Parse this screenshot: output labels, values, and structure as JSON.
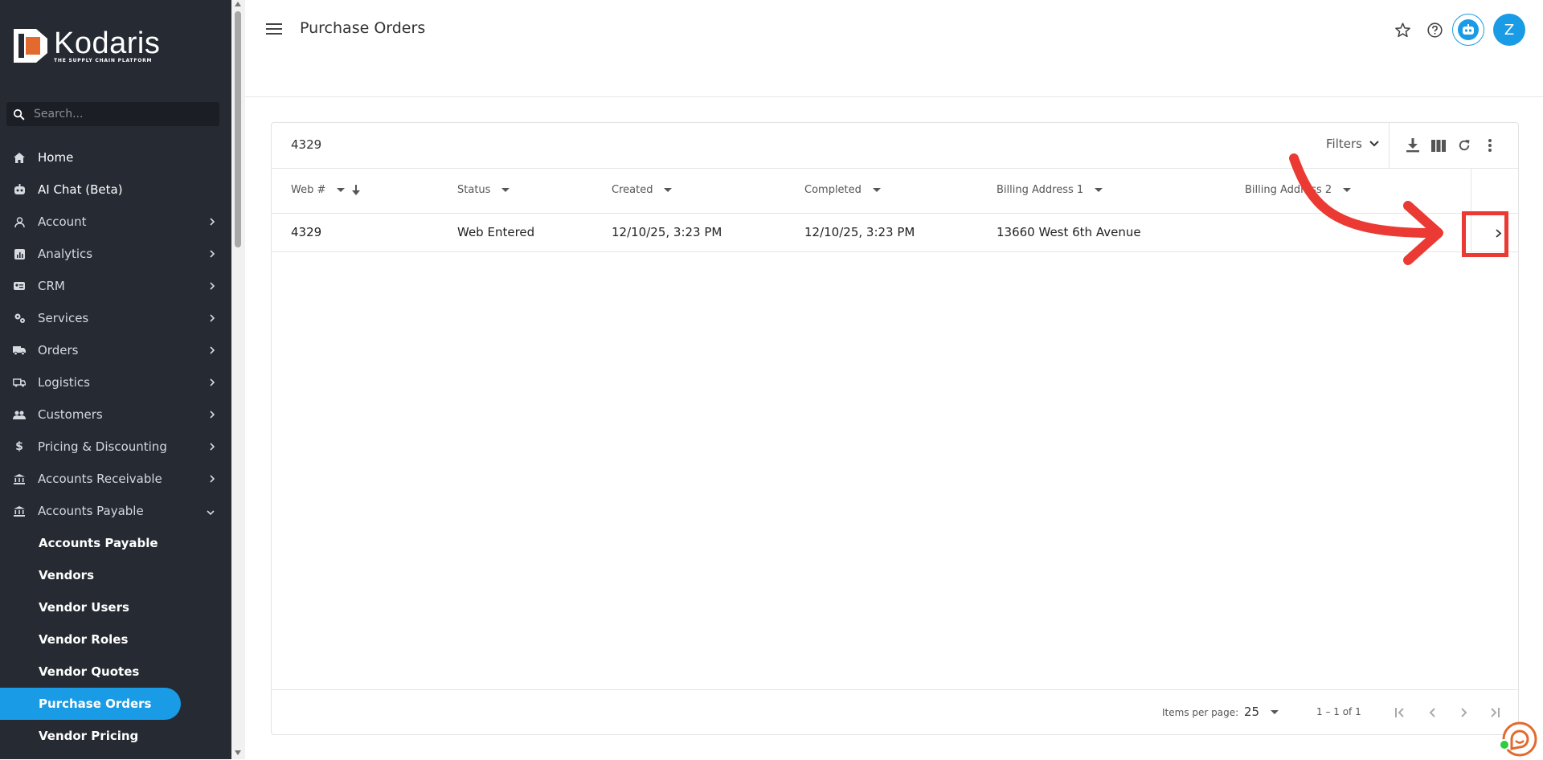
{
  "app": {
    "name": "Kodaris",
    "tagline": "THE SUPPLY CHAIN PLATFORM",
    "accent_color": "#1a9be6",
    "brand_color": "#e36a2e"
  },
  "sidebar": {
    "search_placeholder": "Search...",
    "items": [
      {
        "label": "Home",
        "icon": "home-icon"
      },
      {
        "label": "AI Chat (Beta)",
        "icon": "robot-icon"
      },
      {
        "label": "Account",
        "icon": "person-icon"
      },
      {
        "label": "Analytics",
        "icon": "chart-icon"
      },
      {
        "label": "CRM",
        "icon": "crm-icon"
      },
      {
        "label": "Services",
        "icon": "gears-icon"
      },
      {
        "label": "Orders",
        "icon": "truck-icon"
      },
      {
        "label": "Logistics",
        "icon": "shipping-icon"
      },
      {
        "label": "Customers",
        "icon": "people-icon"
      },
      {
        "label": "Pricing & Discounting",
        "icon": "dollar-icon"
      },
      {
        "label": "Accounts Receivable",
        "icon": "bank-icon"
      },
      {
        "label": "Accounts Payable",
        "icon": "bank-icon"
      }
    ],
    "sub_items": [
      {
        "label": "Accounts Payable"
      },
      {
        "label": "Vendors"
      },
      {
        "label": "Vendor Users"
      },
      {
        "label": "Vendor Roles"
      },
      {
        "label": "Vendor Quotes"
      },
      {
        "label": "Purchase Orders"
      },
      {
        "label": "Vendor Pricing"
      }
    ]
  },
  "header": {
    "title": "Purchase Orders",
    "avatar_initial": "Z"
  },
  "table": {
    "search_value": "4329",
    "filters_label": "Filters",
    "columns": [
      "Web #",
      "Status",
      "Created",
      "Completed",
      "Billing Address 1",
      "Billing Address 2"
    ],
    "rows": [
      {
        "web": "4329",
        "status": "Web Entered",
        "created": "12/10/25, 3:23 PM",
        "completed": "12/10/25, 3:23 PM",
        "billing1": "13660 West 6th Avenue",
        "billing2": ""
      }
    ]
  },
  "pagination": {
    "items_per_page_label": "Items per page:",
    "items_per_page": "25",
    "range": "1 – 1 of 1"
  }
}
